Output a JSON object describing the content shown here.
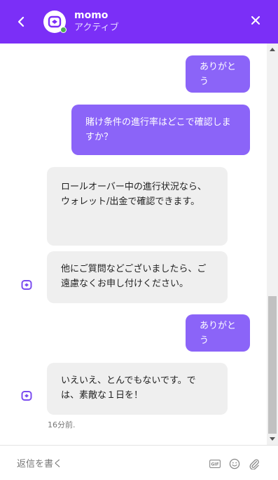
{
  "header": {
    "agent_name": "momo",
    "agent_status": "アクティブ"
  },
  "messages": [
    {
      "from": "user",
      "text": "ありがとう"
    },
    {
      "from": "user",
      "text": "賭け条件の進行率はどこで確認しますか？"
    },
    {
      "from": "bot",
      "text": "ロールオーバー中の進行状況なら、ウォレット/出金で確認できます。"
    },
    {
      "from": "bot",
      "text": "他にご質問などございましたら、ご遠慮なくお申し付けください。"
    },
    {
      "from": "user",
      "text": "ありがとう"
    },
    {
      "from": "bot",
      "text": "いえいえ、とんでもないです。では、素敵な１日を！"
    }
  ],
  "timestamp": "16分前.",
  "composer": {
    "placeholder": "返信を書く",
    "gif_label": "GIF"
  },
  "colors": {
    "brand": "#7b2ff7",
    "user_bubble": "#8b64f8",
    "bot_bubble": "#efefef",
    "online": "#4caf50"
  },
  "icons": [
    "back-arrow-icon",
    "bot-logo-icon",
    "close-icon",
    "gif-icon",
    "emoji-icon",
    "attachment-icon"
  ]
}
